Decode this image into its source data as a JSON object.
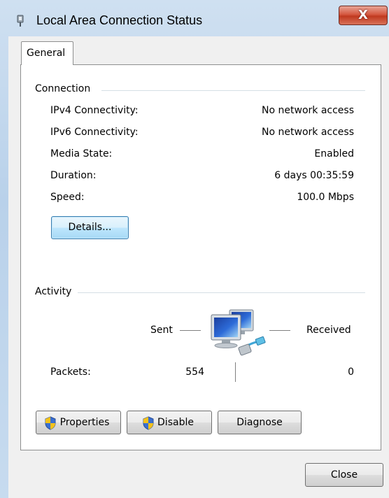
{
  "window": {
    "title": "Local Area Connection Status",
    "close_glyph": "X"
  },
  "tabs": [
    {
      "label": "General",
      "active": true
    }
  ],
  "connection": {
    "heading": "Connection",
    "rows": [
      {
        "label": "IPv4 Connectivity:",
        "value": "No network access"
      },
      {
        "label": "IPv6 Connectivity:",
        "value": "No network access"
      },
      {
        "label": "Media State:",
        "value": "Enabled"
      },
      {
        "label": "Duration:",
        "value": "6 days 00:35:59"
      },
      {
        "label": "Speed:",
        "value": "100.0 Mbps"
      }
    ],
    "details_label": "Details..."
  },
  "activity": {
    "heading": "Activity",
    "sent_label": "Sent",
    "received_label": "Received",
    "packets_label": "Packets:",
    "packets_sent": "554",
    "packets_received": "0",
    "icon": "network-computers-icon"
  },
  "actions": {
    "properties_label": "Properties",
    "disable_label": "Disable",
    "diagnose_label": "Diagnose",
    "close_label": "Close"
  },
  "icons": {
    "title": "network-adapter-icon",
    "shield": "uac-shield-icon"
  }
}
